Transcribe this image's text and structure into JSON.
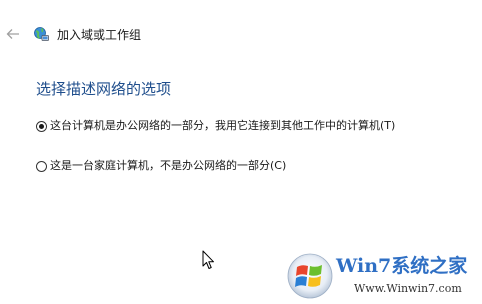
{
  "window": {
    "title": "加入域或工作组"
  },
  "page": {
    "heading": "选择描述网络的选项"
  },
  "options": [
    {
      "label": "这台计算机是办公网络的一部分，我用它连接到其他工作中的计算机(T)",
      "selected": true
    },
    {
      "label": "这是一台家庭计算机，不是办公网络的一部分(C)",
      "selected": false
    }
  ],
  "watermark": {
    "brand": "Win7系统之家",
    "url": "Www.Winwin7.com"
  },
  "icons": {
    "back": "back-arrow-icon",
    "wizard": "network-wizard-icon",
    "cursor": "mouse-pointer-icon",
    "watermark_logo": "windows-logo-icon"
  },
  "colors": {
    "heading": "#1f4e8c",
    "text": "#1a1a1a",
    "background": "#ffffff",
    "disabled_arrow": "#a0a0a0"
  }
}
